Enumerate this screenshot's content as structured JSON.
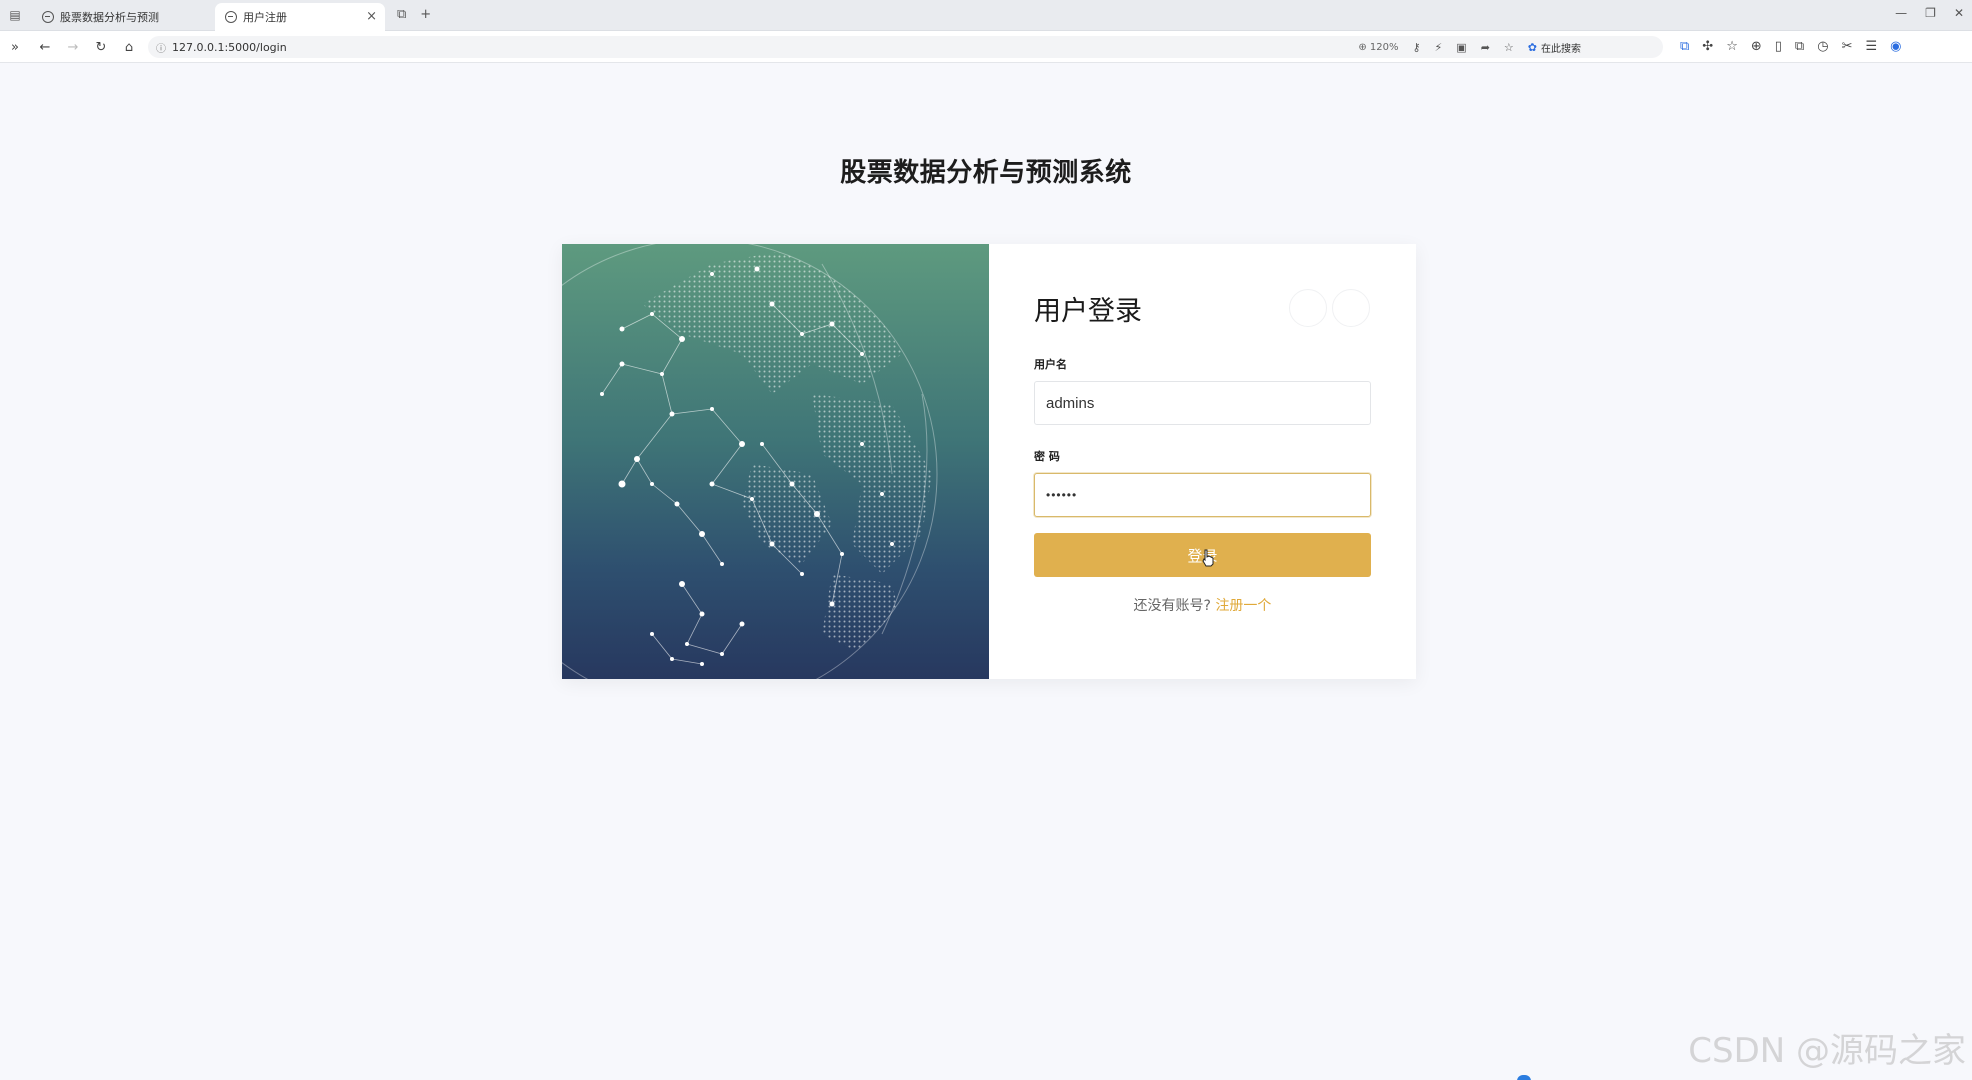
{
  "browser": {
    "tabs": [
      {
        "title": "股票数据分析与预测",
        "active": false
      },
      {
        "title": "用户注册",
        "active": true
      }
    ],
    "url": "127.0.0.1:5000/login",
    "zoom": "120%",
    "search_engine_label": "在此搜索",
    "icons": [
      "sidebar-toggle-icon",
      "new-tab-icon",
      "back-icon",
      "forward-icon",
      "reload-icon",
      "home-icon",
      "zoom-icon",
      "key-icon",
      "lightning-icon",
      "reader-icon",
      "share-icon",
      "star-icon",
      "translate-icon",
      "extension-icon",
      "favorites-icon",
      "download-icon",
      "phone-icon",
      "collections-icon",
      "history-icon",
      "screenshot-icon",
      "menu-icon",
      "profile-icon"
    ]
  },
  "page": {
    "title": "股票数据分析与预测系统"
  },
  "login": {
    "heading": "用户登录",
    "username_label": "用户名",
    "username_value": "admins",
    "password_label": "密 码",
    "password_value": "••••••",
    "submit_label": "登录",
    "register_prompt": "还没有账号?",
    "register_link": "注册一个"
  },
  "colors": {
    "accent": "#e0b04e",
    "link": "#e0a93a",
    "page_background": "#f7f8fc",
    "image_gradient_top": "#5e9a7f",
    "image_gradient_bottom": "#27385f"
  },
  "watermark": "CSDN @源码之家"
}
